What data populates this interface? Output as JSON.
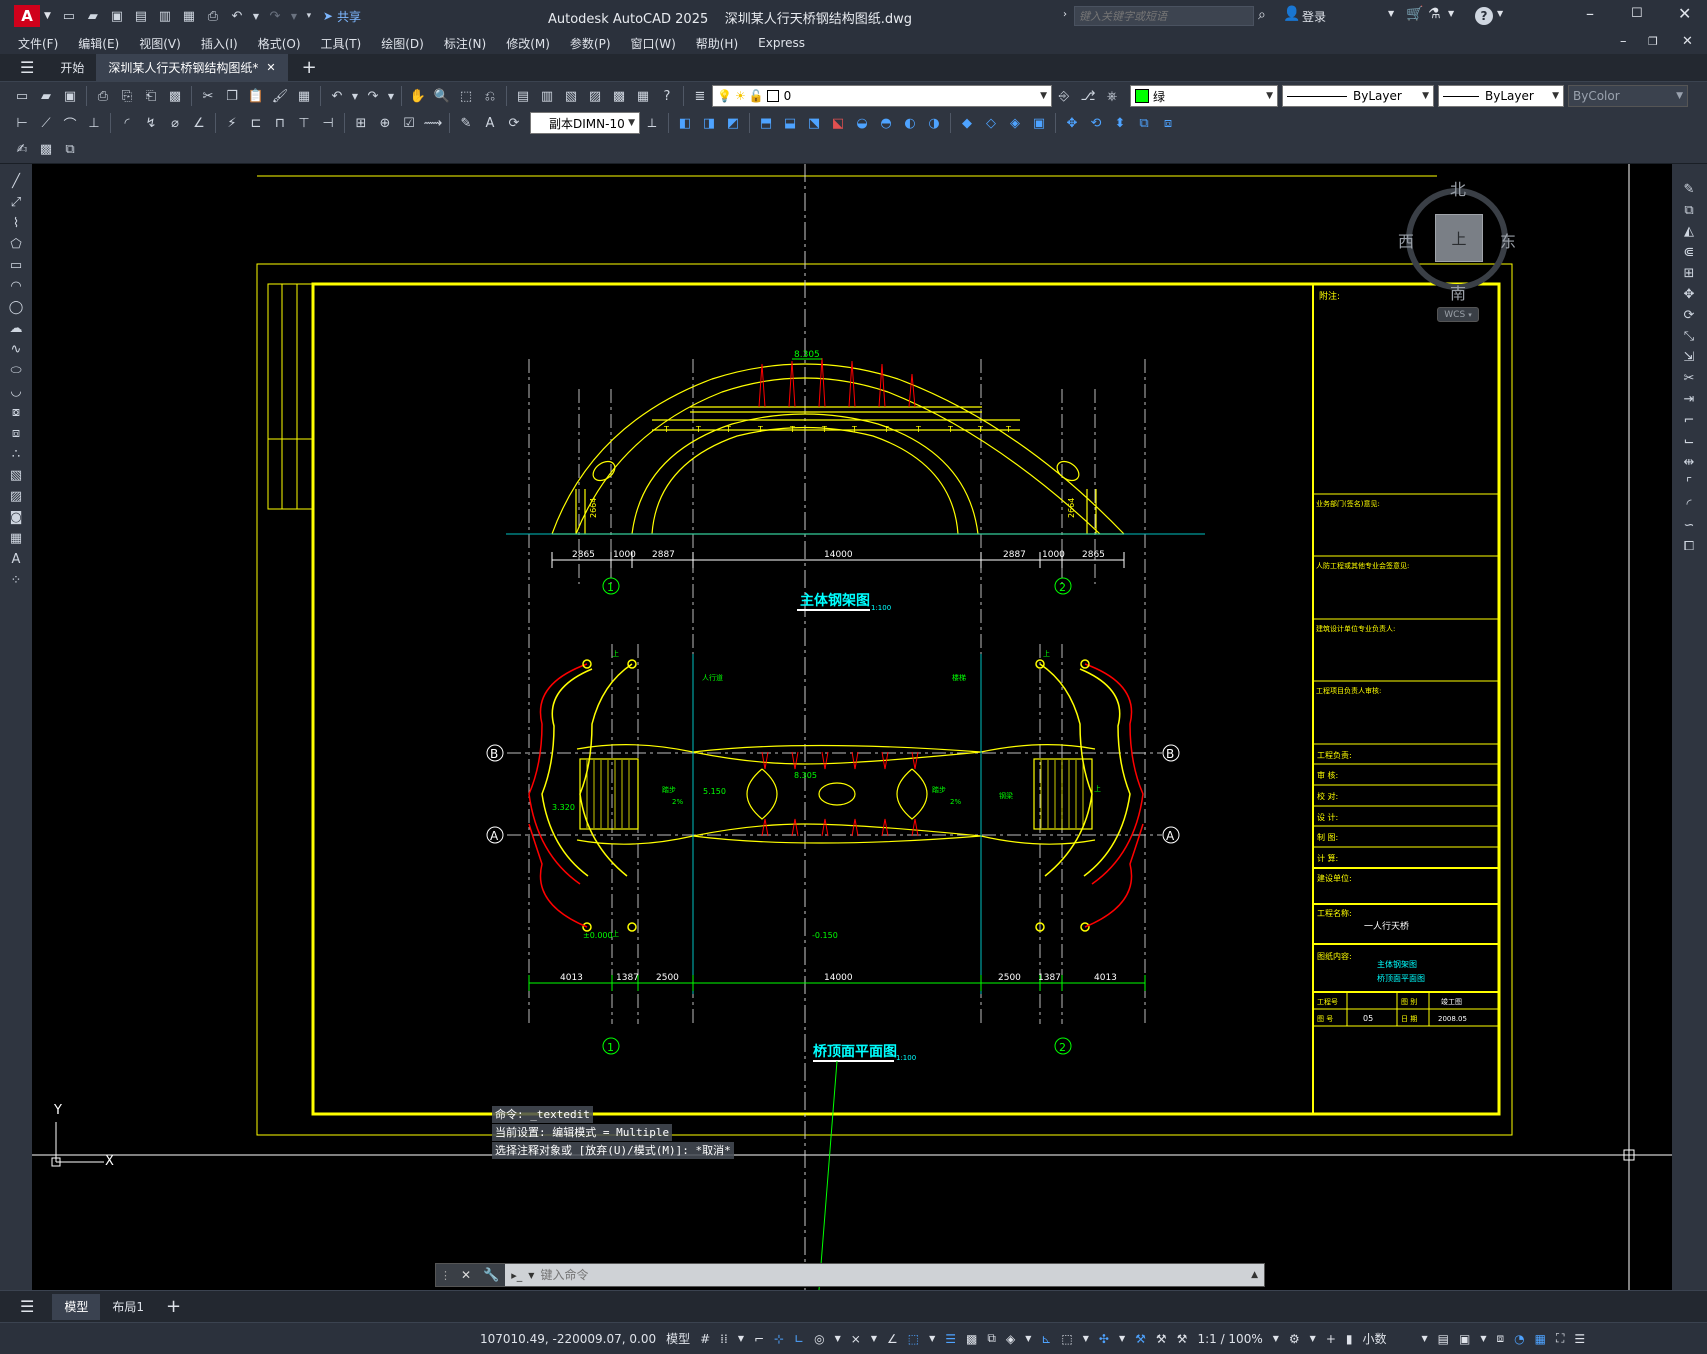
{
  "titlebar": {
    "app_logo": "A",
    "share_label": "共享",
    "title": "Autodesk AutoCAD 2025    深圳某人行天桥钢结构图纸.dwg",
    "search_placeholder": "键入关键字或短语",
    "login_label": "登录",
    "help_label": "?"
  },
  "menu": [
    "文件(F)",
    "编辑(E)",
    "视图(V)",
    "插入(I)",
    "格式(O)",
    "工具(T)",
    "绘图(D)",
    "标注(N)",
    "修改(M)",
    "参数(P)",
    "窗口(W)",
    "帮助(H)",
    "Express"
  ],
  "tabs": {
    "start": "开始",
    "drawing": "深圳某人行天桥钢结构图纸*",
    "add": "+"
  },
  "toolbar": {
    "layer_value": "0",
    "color_value": "绿",
    "linetype_value": "ByLayer",
    "lineweight_value": "ByLayer",
    "plotstyle_value": "ByColor",
    "dimstyle_value": "副本DIMN-10"
  },
  "viewcube": {
    "north": "北",
    "south": "南",
    "east": "东",
    "west": "西",
    "top": "上",
    "wcs": "WCS"
  },
  "drawing": {
    "elevation_title": "主体钢架图",
    "elevation_scale": "1:100",
    "plan_title": "桥顶面平面图",
    "plan_scale": "1:100",
    "elev_dims": [
      "2865",
      "1000",
      "2887",
      "14000",
      "2887",
      "1000",
      "2865"
    ],
    "plan_dims": [
      "4013",
      "1387",
      "2500",
      "14000",
      "2500",
      "1387",
      "4013"
    ],
    "elev_levels": [
      "8.305",
      "2664",
      "2664"
    ],
    "plan_levels": [
      "8.305",
      "5.150",
      "3.320",
      "±0.000",
      "-0.150"
    ],
    "grid_labels": [
      "1",
      "2",
      "B",
      "A"
    ],
    "plan_notes": [
      "人行道",
      "踏步",
      "2%",
      "2%",
      "踏步",
      "楼梯",
      "钢梁",
      "上",
      "上",
      "上",
      "上"
    ],
    "title_block": {
      "remark": "附注:",
      "rows": [
        "业务部门(签名)意见:",
        "人防工程或其他专业会签意见:",
        "建筑设计单位专业负责人:",
        "工程项目负责人审核:",
        "工程负责:",
        "审 核:",
        "校 对:",
        "设 计:",
        "制 图:",
        "计 算:",
        "建设单位:",
        "工程名称:",
        "图纸内容:"
      ],
      "project_name": "一人行天桥",
      "drawing_content_1": "主体钢架图",
      "drawing_content_2": "桥顶面平面图",
      "proj_no_label": "工程号",
      "drawing_no_label": "图 号",
      "drawing_no": "05",
      "sheet_label": "图 别",
      "sheet_value": "竣工图",
      "date_label": "日 期",
      "date_value": "2008.05"
    }
  },
  "ucs": {
    "x": "X",
    "y": "Y"
  },
  "command": {
    "history": [
      "命令: _textedit",
      "当前设置: 编辑模式 = Multiple",
      "选择注释对象或 [放弃(U)/模式(M)]: *取消*"
    ],
    "placeholder": "键入命令"
  },
  "layout_tabs": {
    "model": "模型",
    "layout1": "布局1",
    "add": "+"
  },
  "status": {
    "coords": "107010.49, -220009.07, 0.00",
    "model_label": "模型",
    "scale": "1:1 / 100%",
    "units": "小数"
  },
  "colors": {
    "canvas_bg": "#000000",
    "frame_yellow": "#ffff00",
    "dim_green": "#00ff00",
    "annotation_cyan": "#00ffff",
    "member_red": "#ff0000",
    "chrome_dark": "#2b313c"
  }
}
